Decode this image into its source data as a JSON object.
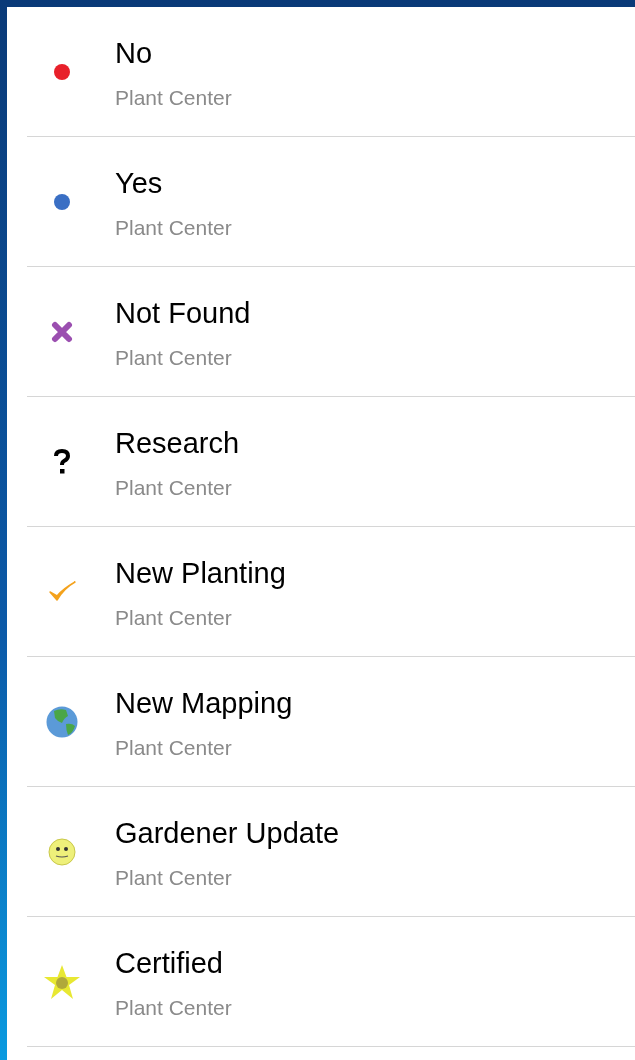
{
  "items": [
    {
      "kind": "dot",
      "color": "#e8202a",
      "title": "No",
      "subtitle": "Plant Center"
    },
    {
      "kind": "dot",
      "color": "#3a6fc4",
      "title": "Yes",
      "subtitle": "Plant Center"
    },
    {
      "kind": "cross",
      "title": "Not Found",
      "subtitle": "Plant Center"
    },
    {
      "kind": "question",
      "title": "Research",
      "subtitle": "Plant Center"
    },
    {
      "kind": "check",
      "title": "New Planting",
      "subtitle": "Plant Center"
    },
    {
      "kind": "globe",
      "title": "New Mapping",
      "subtitle": "Plant Center"
    },
    {
      "kind": "smiley",
      "title": "Gardener Update",
      "subtitle": "Plant Center"
    },
    {
      "kind": "star",
      "title": "Certified",
      "subtitle": "Plant Center"
    }
  ]
}
